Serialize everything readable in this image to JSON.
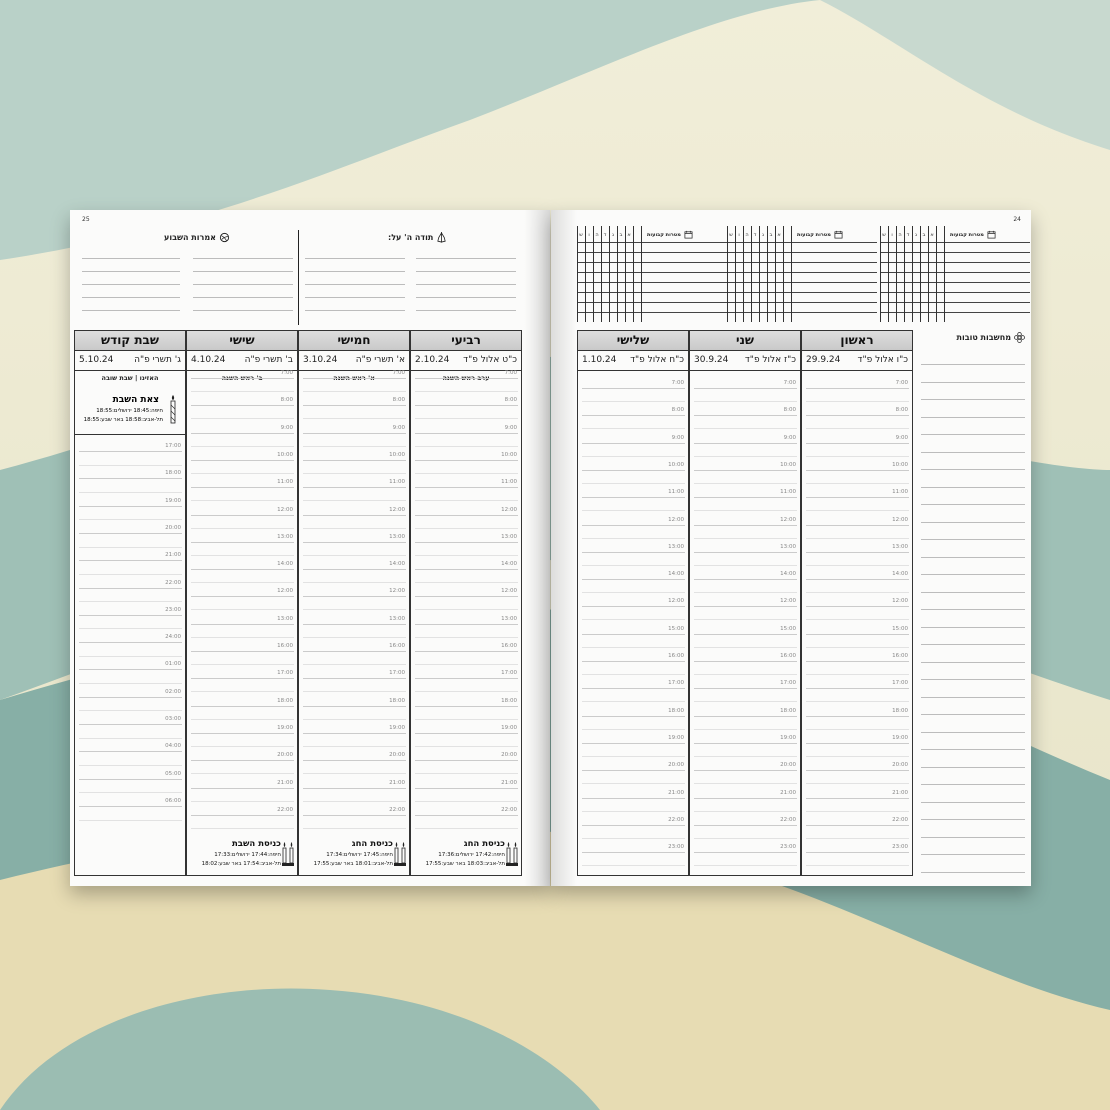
{
  "background": {
    "sky": "#efecd6",
    "sea": "#a8c6bd",
    "sand": "#e9dfb8"
  },
  "left_page": {
    "page_number": "25",
    "top_sections": {
      "right_title": "תודה ה' על:",
      "left_title": "אמרות השבוע"
    },
    "days": [
      {
        "name": "רביעי",
        "greg": "2.10.24",
        "hebrew": "כ\"ט אלול פ\"ד",
        "note": "ערב ראש השנה",
        "footer": {
          "title": "כניסת החג",
          "line1": "חיפה:17:42 ירושלים:17:36",
          "line2": "תל-אביב:18:03 באר שבע:17:55"
        }
      },
      {
        "name": "חמישי",
        "greg": "3.10.24",
        "hebrew": "א' תשרי פ\"ה",
        "note": "א' ראש השנה",
        "footer": {
          "title": "כניסת החג",
          "line1": "חיפה:17:45 ירושלים:17:34",
          "line2": "תל-אביב:18:01 באר שבע:17:55"
        }
      },
      {
        "name": "שישי",
        "greg": "4.10.24",
        "hebrew": "ב' תשרי פ\"ה",
        "note": "ב' ראש השנה",
        "footer": {
          "title": "כניסת השבת",
          "line1": "חיפה:17:44 ירושלים:17:33",
          "line2": "תל-אביב:17:54 באר שבע:18:02"
        }
      },
      {
        "name": "שבת קודש",
        "greg": "5.10.24",
        "hebrew": "ג' תשרי פ\"ה",
        "note": "האזינו | שבת שובה",
        "exit": {
          "title": "צאת השבת",
          "line1": "חיפה:18:45 ירושלים:18:55",
          "line2": "תל-אביב:18:58 באר שבע:18:55"
        }
      }
    ],
    "hours": [
      "7:00",
      "8:00",
      "9:00",
      "10:00",
      "11:00",
      "12:00",
      "13:00",
      "14:00",
      "12:00",
      "13:00",
      "16:00",
      "17:00",
      "18:00",
      "19:00",
      "20:00",
      "21:00",
      "22:00"
    ],
    "shabbat_hours": [
      "17:00",
      "18:00",
      "19:00",
      "20:00",
      "21:00",
      "22:00",
      "23:00",
      "24:00",
      "01:00",
      "02:00",
      "03:00",
      "04:00",
      "05:00",
      "06:00"
    ]
  },
  "right_page": {
    "page_number": "24",
    "habit_titles": [
      "מטרות קבועות",
      "מטרות קבועות",
      "מטרות קבועות"
    ],
    "habit_letters": [
      "א",
      "ב",
      "ג",
      "ד",
      "ה",
      "ו",
      "ש"
    ],
    "days": [
      {
        "name": "ראשון",
        "greg": "29.9.24",
        "hebrew": "כ\"ו אלול פ\"ד"
      },
      {
        "name": "שני",
        "greg": "30.9.24",
        "hebrew": "כ\"ז אלול פ\"ד"
      },
      {
        "name": "שלישי",
        "greg": "1.10.24",
        "hebrew": "כ\"ח אלול פ\"ד"
      }
    ],
    "hours": [
      "7:00",
      "8:00",
      "9:00",
      "10:00",
      "11:00",
      "12:00",
      "13:00",
      "14:00",
      "12:00",
      "15:00",
      "16:00",
      "17:00",
      "18:00",
      "19:00",
      "20:00",
      "21:00",
      "22:00",
      "23:00"
    ],
    "thoughts_title": "מחשבות טובות"
  }
}
